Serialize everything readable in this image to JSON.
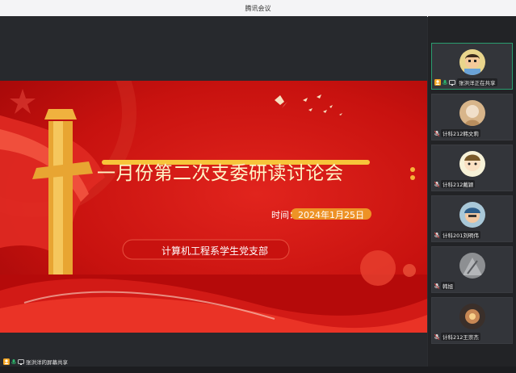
{
  "window": {
    "title": "腾讯会议"
  },
  "slide": {
    "title": "一月份第二次支委研读讨论会",
    "date": "时间：2024年1月25日",
    "org": "计算机工程系学生党支部"
  },
  "share_label": "张洪洋的屏幕共享",
  "participants": [
    {
      "name": "张洪洋正在共享",
      "avatar": "cartoon-boy-avatar"
    },
    {
      "name": "计科212韩文莉",
      "avatar": "photo-avatar"
    },
    {
      "name": "计科212戴颖",
      "avatar": "cartoon-face-avatar"
    },
    {
      "name": "计科201刘明伟",
      "avatar": "cartoon-worker-avatar"
    },
    {
      "name": "韩旭",
      "avatar": "photo-avatar"
    },
    {
      "name": "计科212王崇杰",
      "avatar": "photo-avatar"
    }
  ],
  "colors": {
    "accent": "#2a9d6f",
    "slide_red": "#c8120f",
    "gold": "#f7c43a"
  }
}
